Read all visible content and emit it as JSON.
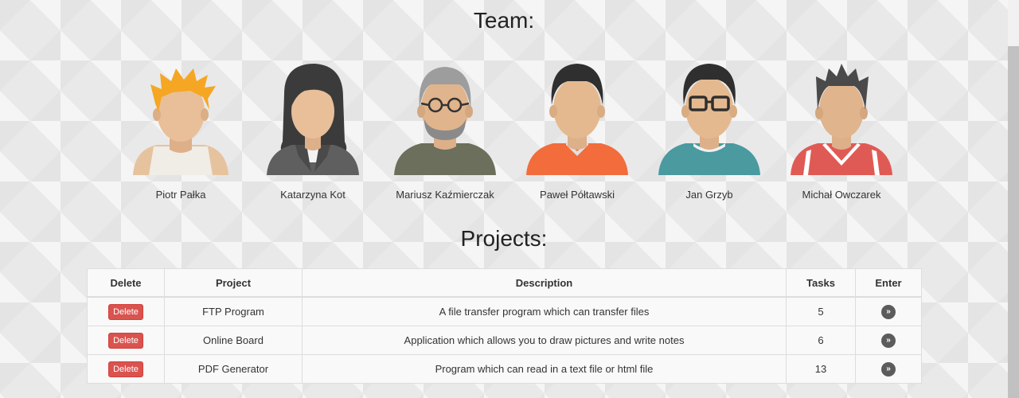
{
  "team": {
    "title": "Team:",
    "members": [
      {
        "name": "Piotr Pałka",
        "avatar": "blond-man-avatar-icon"
      },
      {
        "name": "Katarzyna Kot",
        "avatar": "woman-avatar-icon"
      },
      {
        "name": "Mariusz Kaźmierczak",
        "avatar": "bearded-man-glasses-avatar-icon"
      },
      {
        "name": "Paweł Półtawski",
        "avatar": "man-orange-shirt-avatar-icon"
      },
      {
        "name": "Jan Grzyb",
        "avatar": "man-glasses-avatar-icon"
      },
      {
        "name": "Michał Owczarek",
        "avatar": "man-red-shirt-avatar-icon"
      }
    ]
  },
  "projects": {
    "title": "Projects:",
    "columns": [
      "Delete",
      "Project",
      "Description",
      "Tasks",
      "Enter"
    ],
    "rows": [
      {
        "delete_label": "Delete",
        "project": "FTP Program",
        "description": "A file transfer program which can transfer files",
        "tasks": "5",
        "enter_label": "»"
      },
      {
        "delete_label": "Delete",
        "project": "Online Board",
        "description": "Application which allows you to draw pictures and write notes",
        "tasks": "6",
        "enter_label": "»"
      },
      {
        "delete_label": "Delete",
        "project": "PDF Generator",
        "description": "Program which can read in a text file or html file",
        "tasks": "13",
        "enter_label": "»"
      }
    ]
  },
  "colors": {
    "delete_button": "#d9534f",
    "enter_button": "#5c5c5c",
    "skin": "#e5b98f"
  }
}
